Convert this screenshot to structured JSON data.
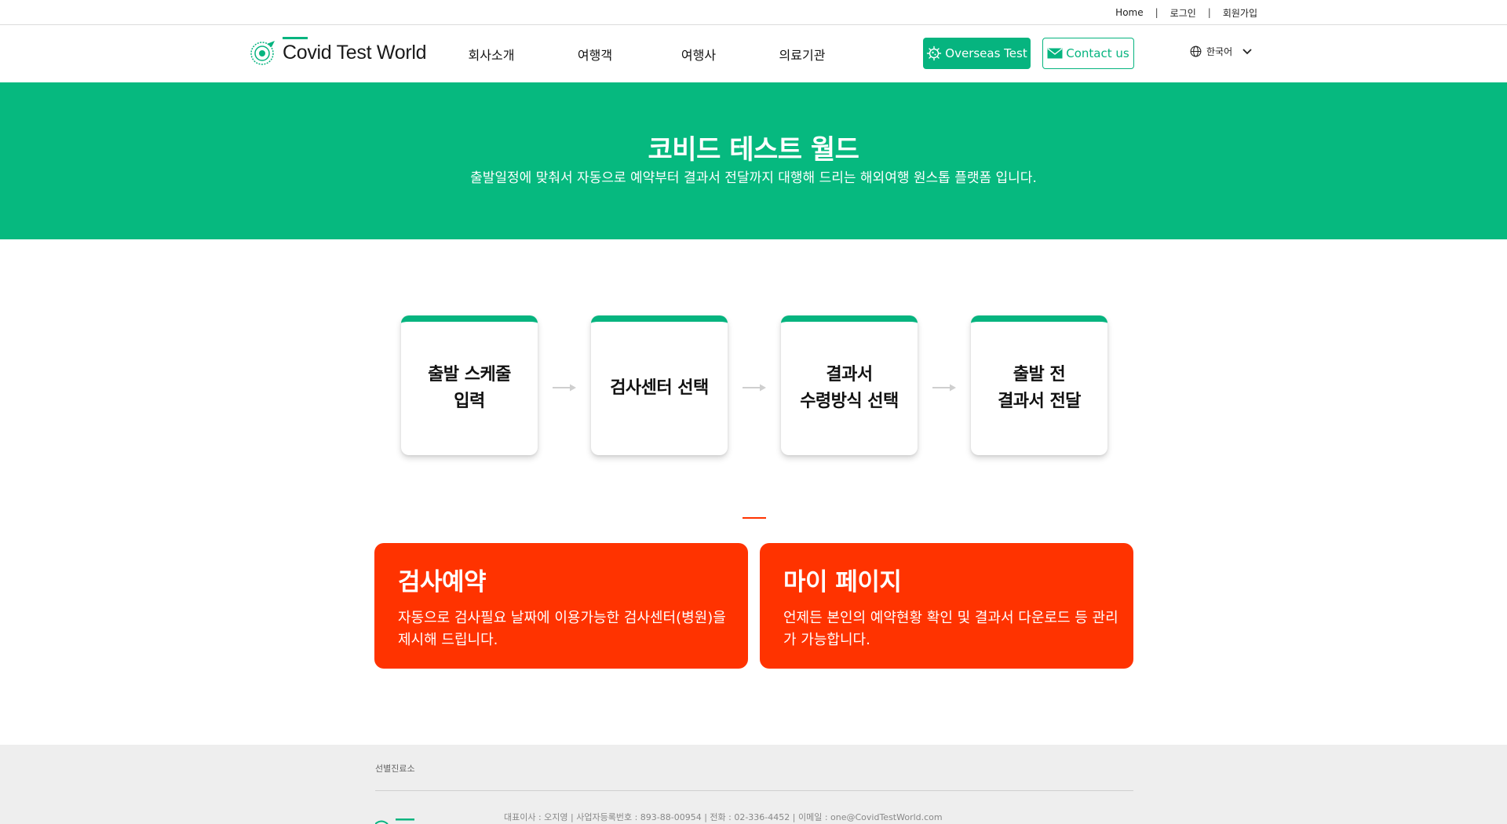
{
  "topbar": {
    "home": "Home",
    "sep": "|",
    "login": "로그인",
    "signup": "회원가입"
  },
  "header": {
    "logo_text": "Covid Test World",
    "nav": [
      "회사소개",
      "여행객",
      "여행사",
      "의료기관"
    ],
    "overseas_button": "Overseas Test",
    "contact_button": "Contact us",
    "language": "한국어"
  },
  "hero": {
    "title": "코비드 테스트 월드",
    "subtitle": "출발일정에 맞춰서 자동으로 예약부터 결과서 전달까지 대행해 드리는 해외여행 원스톱 플랫폼 입니다."
  },
  "steps": [
    "출발 스케줄\n입력",
    "검사센터 선택",
    "결과서\n수령방식 선택",
    "출발 전\n결과서 전달"
  ],
  "cards": {
    "reservation": {
      "title": "검사예약",
      "desc": "자동으로 검사필요 날짜에 이용가능한 검사센터(병원)을 제시해 드립니다."
    },
    "mypage": {
      "title": "마이 페이지",
      "desc": "언제든 본인의 예약현황 확인 및 결과서 다운로드 등 관리가 가능합니다."
    }
  },
  "footer": {
    "link": "선별진료소",
    "info": "대표이사 : 오지영  |  사업자등록번호 : 893-88-00954  |  전화 : 02-336-4452  |  이메일 : one@CovidTestWorld.com"
  },
  "colors": {
    "brand_green": "#06b47f",
    "hero_green": "#06b97f",
    "accent_red": "#ff3300",
    "footer_bg": "#eeeeee"
  },
  "icons": [
    "logo-globe-icon",
    "virus-icon",
    "mail-icon",
    "globe-icon",
    "chevron-down-icon",
    "arrow-right-icon"
  ]
}
